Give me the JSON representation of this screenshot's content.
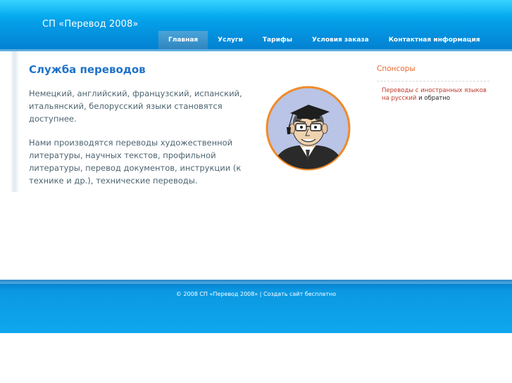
{
  "header": {
    "site_title": "СП «Перевод 2008»",
    "nav": [
      {
        "label": "Главная",
        "active": true
      },
      {
        "label": "Услуги",
        "active": false
      },
      {
        "label": "Тарифы",
        "active": false
      },
      {
        "label": "Условия заказа",
        "active": false
      },
      {
        "label": "Контактная информация",
        "active": false
      }
    ]
  },
  "main": {
    "heading": "Служба переводов",
    "paragraph1": "Немецкий, английский, французский, испанский, итальянский, белорусский языки становятся доступнее.",
    "paragraph2": "Нами производятся переводы художественной литературы, научных текстов, профильной литературы, перевод документов, инструкции (к технике и др.), технические переводы."
  },
  "sidebar": {
    "heading": "Спонсоры",
    "sponsor_link": "Переводы с иностранных языков на русский",
    "sponsor_suffix": " и обратно"
  },
  "footer": {
    "copyright": "© 2008 СП «Перевод 2008» | ",
    "link": "Создать сайт бесплатно"
  },
  "colors": {
    "header_blue": "#049ee8",
    "heading_blue": "#1f72c8",
    "sponsor_orange": "#e8692e",
    "link_red": "#c0392b"
  }
}
